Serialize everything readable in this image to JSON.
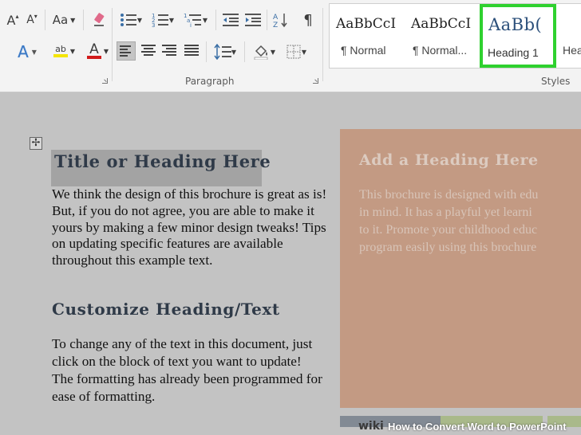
{
  "ribbon": {
    "font_group": {
      "change_case_label": "Aa",
      "grow_font_glyph": "A",
      "shrink_font_glyph": "A",
      "text_effects_glyph": "A",
      "highlight_glyph": "ab",
      "font_color_glyph": "A",
      "font_color": "#d11b1b",
      "highlight_color": "#f4e500"
    },
    "paragraph_group": {
      "label": "Paragraph",
      "pilcrow": "¶"
    },
    "styles_group": {
      "label": "Styles",
      "items": [
        {
          "preview": "AaBbCcI",
          "name": "¶ Normal"
        },
        {
          "preview": "AaBbCcI",
          "name": "¶ Normal..."
        },
        {
          "preview": "AaBb(",
          "name": "Heading 1"
        },
        {
          "preview": "",
          "name": "Hea"
        }
      ],
      "highlight_color": "#2fd12f"
    }
  },
  "document": {
    "title_heading": "Title or Heading Here",
    "body1": "We think the design of this brochure is great as is!  But, if you do not agree, you are able to make it yours by making a few minor design tweaks!  Tips on updating specific features are available throughout this example text.",
    "heading2": "Customize Heading/Text",
    "body2": "To change any of the text in this document, just click on the block of text you want to update!  The formatting has already been programmed for ease of formatting.",
    "side_panel": {
      "heading": "Add a Heading Here",
      "body_lines": [
        "This brochure is designed with edu",
        "in mind.  It has a playful yet learni",
        "to it.  Promote your childhood educ",
        "program easily using this brochure"
      ],
      "color": "#c39a83"
    }
  },
  "watermark": {
    "wiki": "wiki",
    "how": "How to Convert Word to PowerPoint"
  }
}
